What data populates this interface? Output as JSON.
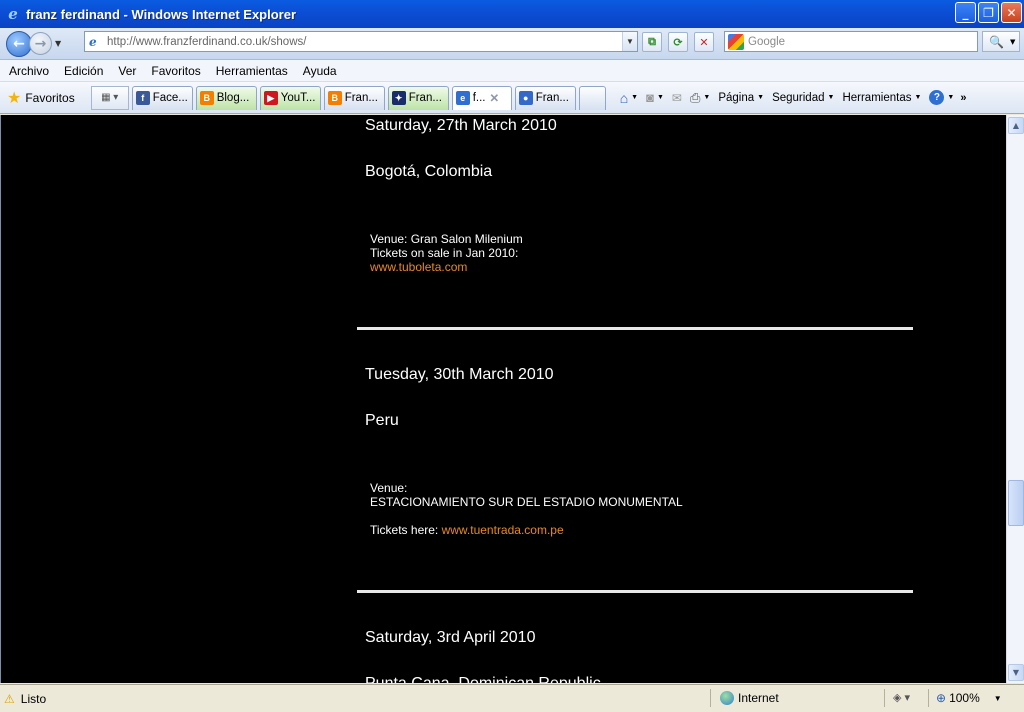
{
  "window": {
    "title": "franz ferdinand - Windows Internet Explorer",
    "minimize": "_",
    "restore": "❐",
    "close": "✕"
  },
  "address": {
    "url_domain": "http://www.franzferdinand.co.uk",
    "url_path": "/shows/"
  },
  "search": {
    "placeholder": "Google"
  },
  "menu": [
    "Archivo",
    "Edición",
    "Ver",
    "Favoritos",
    "Herramientas",
    "Ayuda"
  ],
  "favorites": {
    "label": "Favoritos",
    "tabs": [
      {
        "label": "Face...",
        "icon": "facebook-icon",
        "color": "#3b5998",
        "glyph": "f"
      },
      {
        "label": "Blog...",
        "icon": "blogger-icon",
        "color": "#f57d00",
        "glyph": "B"
      },
      {
        "label": "YouT...",
        "icon": "youtube-icon",
        "color": "#cc181e",
        "glyph": "▶"
      },
      {
        "label": "Fran...",
        "icon": "blogger-icon",
        "color": "#f57d00",
        "glyph": "B"
      },
      {
        "label": "Fran...",
        "icon": "star-logo-icon",
        "color": "#1a2d6b",
        "glyph": "✦"
      },
      {
        "label": "f...",
        "icon": "ie-page-icon",
        "color": "#2f6fd2",
        "glyph": "e"
      },
      {
        "label": "Fran...",
        "icon": "people-icon",
        "color": "#3569c9",
        "glyph": "👥"
      }
    ],
    "commands": [
      "Página",
      "Seguridad",
      "Herramientas"
    ]
  },
  "shows": [
    {
      "date": "Saturday, 27th March 2010",
      "city": "Bogotá, Colombia",
      "lines": [
        "Venue: Gran Salon Milenium",
        "Tickets on sale in Jan 2010:"
      ],
      "link": "www.tuboleta.com"
    },
    {
      "date": "Tuesday, 30th March 2010",
      "city": "Peru",
      "lines": [
        "Venue:",
        "ESTACIONAMIENTO SUR DEL ESTADIO MONUMENTAL"
      ],
      "tickets_label": "Tickets here: ",
      "link": "www.tuentrada.com.pe"
    },
    {
      "date": "Saturday, 3rd April 2010",
      "city": "Punta Cana, Dominican Republic"
    }
  ],
  "status": {
    "text": "Listo",
    "zone": "Internet",
    "zoom": "100%"
  },
  "colors": {
    "link": "#e98a1c",
    "background": "#000000"
  }
}
